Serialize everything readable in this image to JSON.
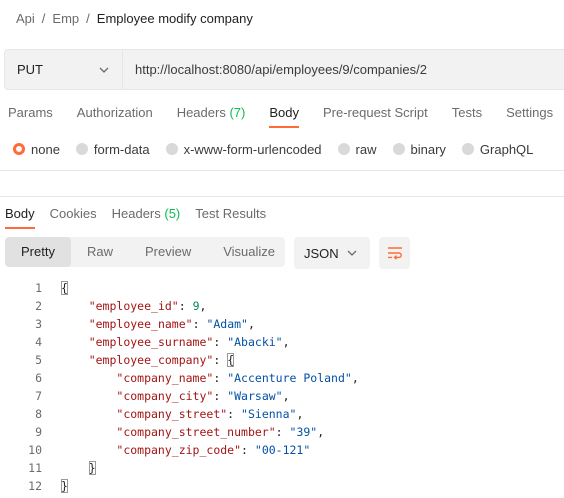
{
  "breadcrumb": {
    "items": [
      "Api",
      "Emp"
    ],
    "separator": "/",
    "current": "Employee modify company"
  },
  "request": {
    "method": "PUT",
    "url": "http://localhost:8080/api/employees/9/companies/2"
  },
  "request_tabs": [
    {
      "label": "Params"
    },
    {
      "label": "Authorization"
    },
    {
      "label": "Headers",
      "count": "(7)"
    },
    {
      "label": "Body",
      "active": true
    },
    {
      "label": "Pre-request Script"
    },
    {
      "label": "Tests"
    },
    {
      "label": "Settings"
    }
  ],
  "body_types": [
    {
      "label": "none",
      "selected": true
    },
    {
      "label": "form-data"
    },
    {
      "label": "x-www-form-urlencoded"
    },
    {
      "label": "raw"
    },
    {
      "label": "binary"
    },
    {
      "label": "GraphQL"
    }
  ],
  "response_tabs": [
    {
      "label": "Body",
      "active": true
    },
    {
      "label": "Cookies"
    },
    {
      "label": "Headers",
      "count": "(5)"
    },
    {
      "label": "Test Results"
    }
  ],
  "view_tabs": [
    {
      "label": "Pretty",
      "active": true
    },
    {
      "label": "Raw"
    },
    {
      "label": "Preview"
    },
    {
      "label": "Visualize"
    }
  ],
  "format": "JSON",
  "wrap_icon": "wrap-lines-icon",
  "code_lines": [
    {
      "num": "1",
      "text": "{"
    },
    {
      "num": "2",
      "text": "    \"employee_id\": 9,"
    },
    {
      "num": "3",
      "text": "    \"employee_name\": \"Adam\","
    },
    {
      "num": "4",
      "text": "    \"employee_surname\": \"Abacki\","
    },
    {
      "num": "5",
      "text": "    \"employee_company\": {"
    },
    {
      "num": "6",
      "text": "        \"company_name\": \"Accenture Poland\","
    },
    {
      "num": "7",
      "text": "        \"company_city\": \"Warsaw\","
    },
    {
      "num": "8",
      "text": "        \"company_street\": \"Sienna\","
    },
    {
      "num": "9",
      "text": "        \"company_street_number\": \"39\","
    },
    {
      "num": "10",
      "text": "        \"company_zip_code\": \"00-121\""
    },
    {
      "num": "11",
      "text": "    }"
    },
    {
      "num": "12",
      "text": "}"
    }
  ],
  "colors": {
    "accent": "#ff6c37",
    "count": "#0cbb52",
    "json_key": "#a31515",
    "json_string": "#0451a5",
    "json_number": "#098658"
  }
}
